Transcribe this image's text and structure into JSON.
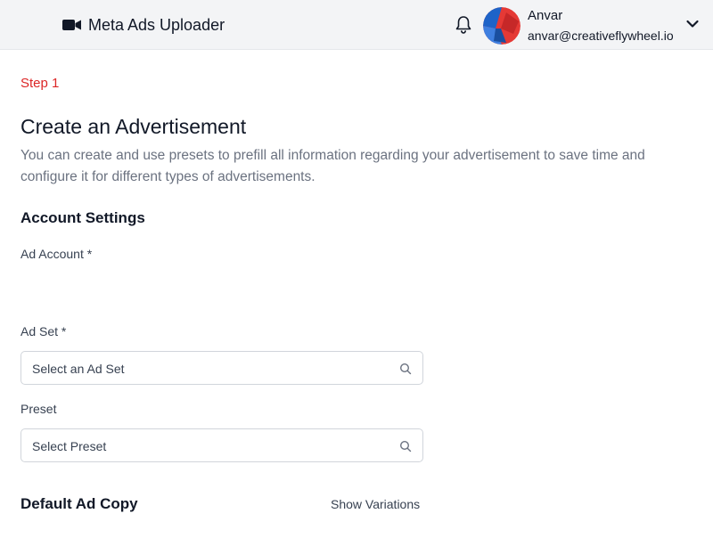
{
  "header": {
    "app_title": "Meta Ads Uploader",
    "brand_icon": "video-camera-icon",
    "notification_icon": "bell-icon",
    "user": {
      "name": "Anvar",
      "email": "anvar@creativeflywheel.io"
    },
    "menu_icon": "chevron-down-icon"
  },
  "page": {
    "step": "Step 1",
    "title": "Create an Advertisement",
    "description": "You can create and use presets to prefill all information regarding your advertisement to save time and configure it for different types of advertisements."
  },
  "account_settings": {
    "heading": "Account Settings",
    "ad_account_label": "Ad Account *",
    "ad_set_label": "Ad Set *",
    "ad_set_placeholder": "Select an Ad Set",
    "preset_label": "Preset",
    "preset_placeholder": "Select Preset",
    "search_icon": "search-icon"
  },
  "default_ad_copy": {
    "heading": "Default Ad Copy",
    "show_variations_label": "Show Variations"
  },
  "colors": {
    "accent_red": "#dc2626",
    "header_bg": "#f3f4f6",
    "text_dark": "#111827",
    "text_muted": "#6b7280"
  }
}
